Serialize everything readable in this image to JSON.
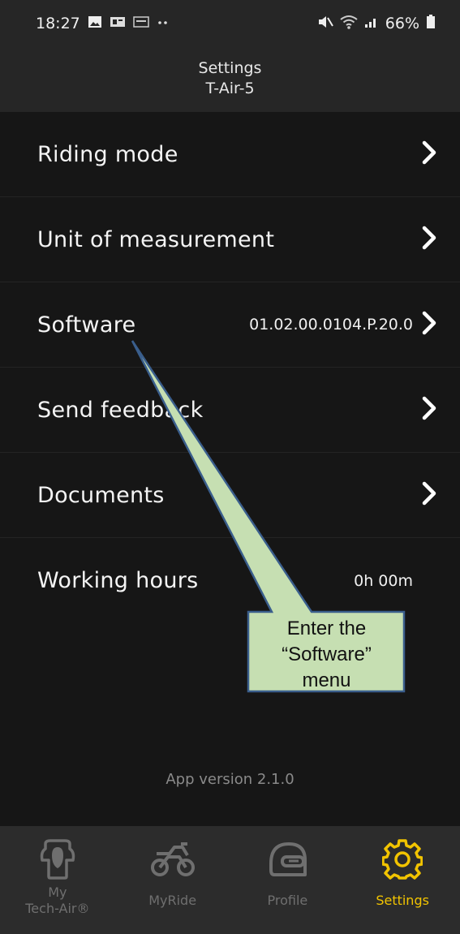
{
  "status_bar": {
    "time": "18:27",
    "battery": "66%",
    "icons": [
      "image-icon",
      "app-icon",
      "app-icon",
      "more-dots-icon",
      "mute-icon",
      "wifi-icon",
      "signal-icon",
      "battery-icon"
    ]
  },
  "header": {
    "title": "Settings",
    "subtitle": "T-Air-5"
  },
  "menu": {
    "items": [
      {
        "label": "Riding mode",
        "value": "",
        "chevron": true
      },
      {
        "label": "Unit of measurement",
        "value": "",
        "chevron": true
      },
      {
        "label": "Software",
        "value": "01.02.00.0104.P.20.0",
        "chevron": true
      },
      {
        "label": "Send feedback",
        "value": "",
        "chevron": true
      },
      {
        "label": "Documents",
        "value": "",
        "chevron": true
      },
      {
        "label": "Working hours",
        "value": "0h 00m",
        "chevron": false
      }
    ]
  },
  "app_version": "App version 2.1.0",
  "callout": {
    "lines": [
      "Enter the",
      "“Software”",
      "menu"
    ],
    "fill": "#c6dfb2",
    "stroke": "#3a5e8c"
  },
  "bottom_nav": {
    "items": [
      {
        "label_line1": "My",
        "label_line2": "Tech-Air®",
        "icon": "airbag-vest-icon",
        "active": false
      },
      {
        "label_line1": "MyRide",
        "label_line2": "",
        "icon": "motorcycle-icon",
        "active": false
      },
      {
        "label_line1": "Profile",
        "label_line2": "",
        "icon": "helmet-icon",
        "active": false
      },
      {
        "label_line1": "Settings",
        "label_line2": "",
        "icon": "gear-icon",
        "active": true
      }
    ],
    "active_color": "#f2c400",
    "inactive_color": "#6f6f6f"
  }
}
